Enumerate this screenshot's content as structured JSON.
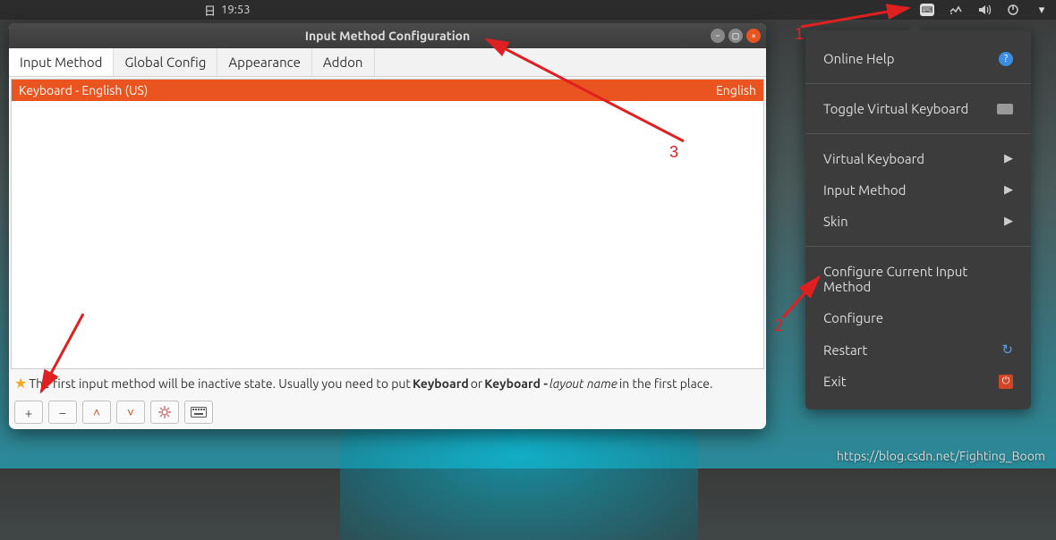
{
  "topbar": {
    "clock_day": "日",
    "clock_time": "19:53"
  },
  "window": {
    "title": "Input Method Configuration",
    "tabs": [
      "Input Method",
      "Global Config",
      "Appearance",
      "Addon"
    ],
    "list": {
      "name": "Keyboard - English (US)",
      "lang": "English"
    },
    "hint": {
      "pre": "The first input method will be inactive state. Usually you need to put ",
      "b1": "Keyboard",
      "mid": " or ",
      "b2": "Keyboard - ",
      "i1": "layout name",
      "post": " in the first place."
    }
  },
  "menu": {
    "online_help": "Online Help",
    "toggle_vk": "Toggle Virtual Keyboard",
    "virtual_keyboard": "Virtual Keyboard",
    "input_method": "Input Method",
    "skin": "Skin",
    "configure_current": "Configure Current Input Method",
    "configure": "Configure",
    "restart": "Restart",
    "exit": "Exit"
  },
  "annotations": {
    "n1": "1",
    "n2": "2",
    "n3": "3"
  },
  "watermark": "https://blog.csdn.net/Fighting_Boom"
}
